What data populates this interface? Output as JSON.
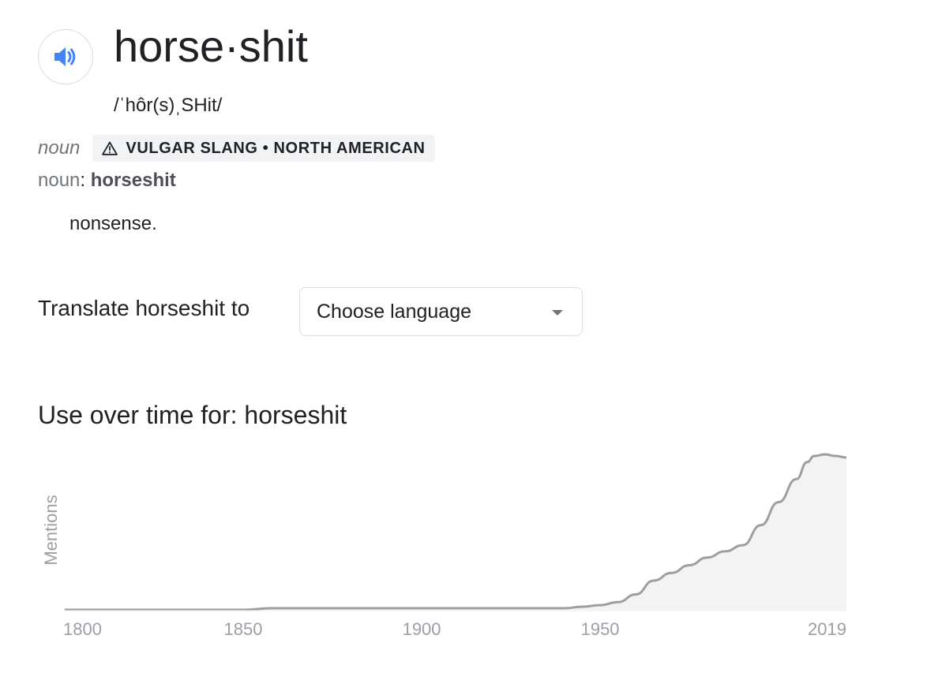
{
  "entry": {
    "word": "horse·shit",
    "phonetic": "/ˈhôr(s)ˌSHit/",
    "audio_icon": "speaker-icon",
    "part_of_speech": "noun",
    "usage_label": "VULGAR SLANG • NORTH AMERICAN",
    "warning_icon": "warning-triangle-icon",
    "forms_pos": "noun",
    "forms_colon": ":",
    "forms_word": "horseshit",
    "definition": "nonsense."
  },
  "translate": {
    "label": "Translate horseshit to",
    "selected": "Choose language"
  },
  "usage": {
    "title": "Use over time for: horseshit"
  },
  "colors": {
    "accent_blue": "#4285f4",
    "line_gray": "#9e9e9e",
    "area_fill": "#f3f3f3",
    "axis_text": "#9aa0a6"
  },
  "chart_data": {
    "type": "area",
    "title": "",
    "xlabel": "",
    "ylabel": "Mentions",
    "x_tick_labels": [
      "1800",
      "1850",
      "1900",
      "1950",
      "2019"
    ],
    "xlim": [
      1800,
      2019
    ],
    "ylim": [
      0,
      100
    ],
    "grid": false,
    "legend": "none",
    "series": [
      {
        "x": [
          1800,
          1850,
          1858,
          1900,
          1940,
          1945,
          1950,
          1955,
          1960,
          1965,
          1970,
          1975,
          1980,
          1985,
          1990,
          1995,
          2000,
          2005,
          2008,
          2010,
          2013,
          2016,
          2019
        ],
        "y": [
          0,
          0,
          1,
          1,
          1,
          2,
          3,
          5,
          10,
          19,
          24,
          29,
          34,
          38,
          42,
          55,
          70,
          85,
          96,
          100,
          101,
          100,
          99
        ]
      }
    ]
  }
}
